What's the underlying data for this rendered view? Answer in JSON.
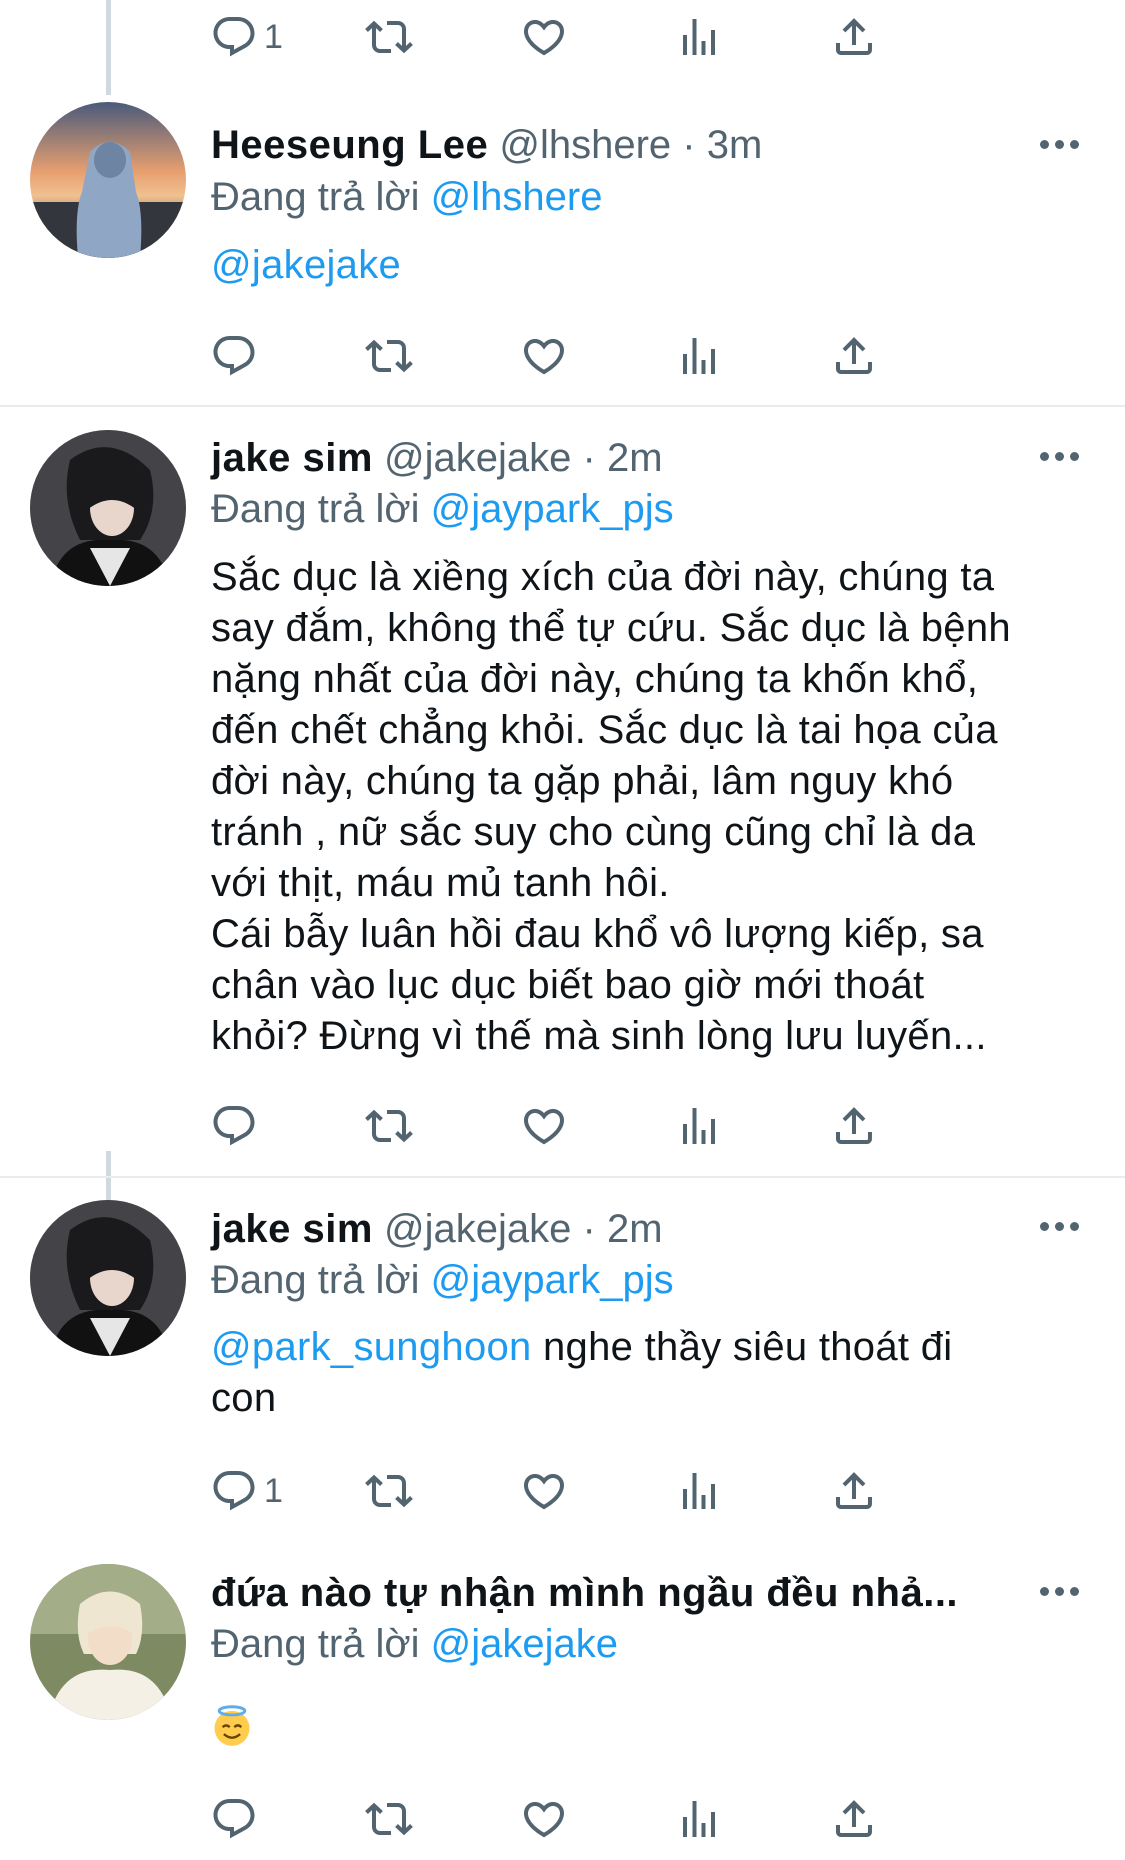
{
  "reply_label": "Đang trả lời",
  "colors": {
    "link": "#1d9bf0",
    "muted": "#536471",
    "text": "#0f1419"
  },
  "tweets": [
    {
      "id": "top-partial",
      "actions": {
        "reply_count": "1"
      }
    },
    {
      "id": "heeseung",
      "display_name": "Heeseung Lee",
      "handle": "@lhshere",
      "separator": "·",
      "time": "3m",
      "replying_to": "@lhshere",
      "mention": "@jakejake",
      "text": "",
      "avatar_icon": "avatar-hoodie-sunset",
      "actions": {
        "reply_count": ""
      }
    },
    {
      "id": "jake-long",
      "display_name": "jake sim",
      "handle": "@jakejake",
      "separator": "·",
      "time": "2m",
      "replying_to": "@jaypark_pjs",
      "lines": [
        "Sắc dục là xiềng xích của đời này, chúng ta",
        "say đắm, không thể tự cứu. Sắc dục là bệnh",
        "nặng nhất của đời này, chúng ta khốn khổ,",
        "đến chết chẳng khỏi. Sắc dục là tai họa của",
        "đời này, chúng ta gặp phải, lâm nguy khó",
        "tránh , nữ sắc suy cho cùng cũng chỉ là da",
        "với thịt, máu mủ tanh hôi.",
        "Cái bẫy luân hồi đau khổ vô lượng kiếp, sa",
        "chân vào lục dục biết bao giờ mới thoát",
        "khỏi? Đừng vì thế mà sinh lòng lưu luyến..."
      ],
      "avatar_icon": "avatar-dark-hair",
      "actions": {
        "reply_count": ""
      }
    },
    {
      "id": "jake-short",
      "display_name": "jake sim",
      "handle": "@jakejake",
      "separator": "·",
      "time": "2m",
      "replying_to": "@jaypark_pjs",
      "mention": "@park_sunghoon",
      "text_line1": "nghe thầy siêu thoát đi",
      "text_line2": "con",
      "avatar_icon": "avatar-dark-hair",
      "actions": {
        "reply_count": "1"
      }
    },
    {
      "id": "sunghoon",
      "display_name": "đứa nào tự nhận mình ngầu đều nhả...",
      "replying_to": "@jakejake",
      "emoji": "smiling-face-with-halo-icon",
      "avatar_icon": "avatar-blonde",
      "actions": {
        "reply_count": ""
      }
    }
  ]
}
